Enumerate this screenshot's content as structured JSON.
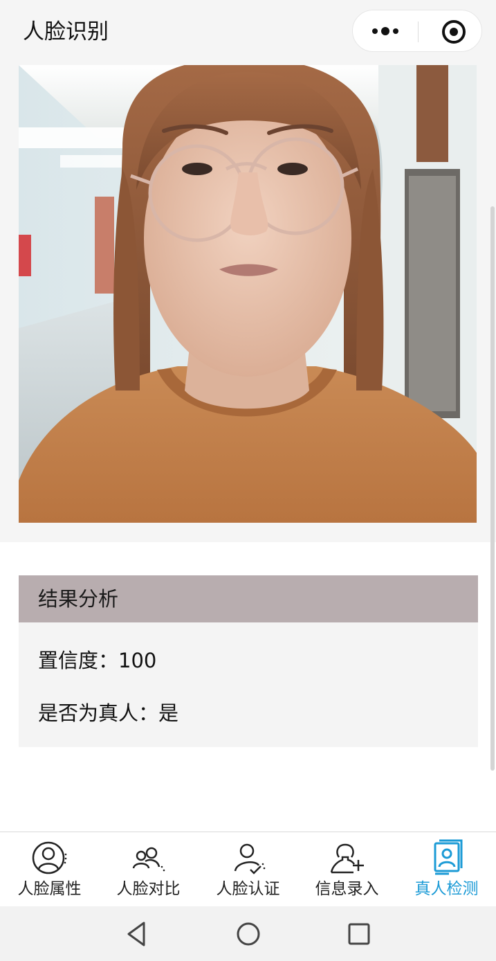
{
  "header": {
    "title": "人脸识别",
    "more_icon": "more-dots-icon",
    "close_icon": "target-circle-icon"
  },
  "photo": {
    "description_icon": "face-photo"
  },
  "result": {
    "title": "结果分析",
    "confidence_line": "置信度：100",
    "is_real_line": "是否为真人：是"
  },
  "tabbar": {
    "active_color": "#1c9bd6",
    "items": [
      {
        "label": "人脸属性",
        "icon": "face-attribute-icon",
        "active": false
      },
      {
        "label": "人脸对比",
        "icon": "face-compare-icon",
        "active": false
      },
      {
        "label": "人脸认证",
        "icon": "face-verify-icon",
        "active": false
      },
      {
        "label": "信息录入",
        "icon": "info-entry-icon",
        "active": false
      },
      {
        "label": "真人检测",
        "icon": "liveness-detect-icon",
        "active": true
      }
    ]
  },
  "system_nav": {
    "back_icon": "back-triangle-icon",
    "home_icon": "home-circle-icon",
    "recents_icon": "recents-square-icon"
  }
}
